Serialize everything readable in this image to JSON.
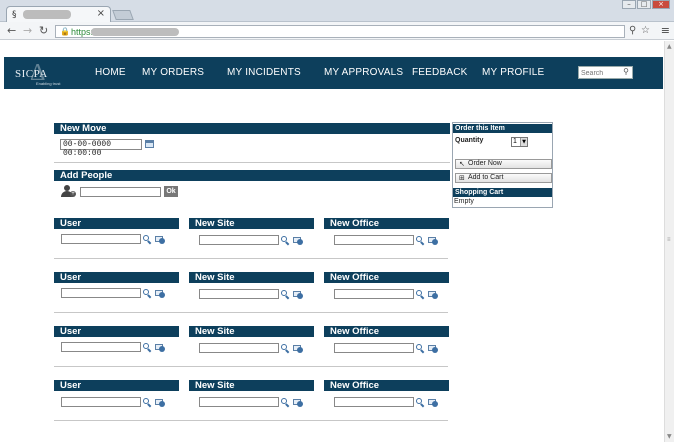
{
  "browser": {
    "tab_favicon": "§",
    "tab_close": "×",
    "url_scheme": "https://",
    "window_controls": [
      "–",
      "□",
      "×"
    ],
    "nav_buttons": [
      "←",
      "→",
      "↻"
    ]
  },
  "header": {
    "logo_text": "SICPA",
    "logo_tagline": "Enabling trust",
    "nav": [
      "HOME",
      "MY ORDERS",
      "MY INCIDENTS",
      "MY APPROVALS",
      "FEEDBACK",
      "MY PROFILE"
    ],
    "search_placeholder": "Search"
  },
  "new_move": {
    "title": "New Move",
    "date_value": "00-00-0000 00:00:00"
  },
  "add_people": {
    "title": "Add People",
    "ok_label": "Ok"
  },
  "rows": [
    {
      "user": "User",
      "site": "New Site",
      "office": "New Office"
    },
    {
      "user": "User",
      "site": "New Site",
      "office": "New Office"
    },
    {
      "user": "User",
      "site": "New Site",
      "office": "New Office"
    },
    {
      "user": "User",
      "site": "New Site",
      "office": "New Office"
    }
  ],
  "order_panel": {
    "title": "Order this Item",
    "quantity_label": "Quantity",
    "quantity_value": "1",
    "order_now": "Order Now",
    "add_to_cart": "Add to Cart",
    "cart_title": "Shopping Cart",
    "cart_status": "Empty"
  },
  "colors": {
    "brand_navy": "#0d3f5c",
    "link_green": "#2e8b3a"
  }
}
